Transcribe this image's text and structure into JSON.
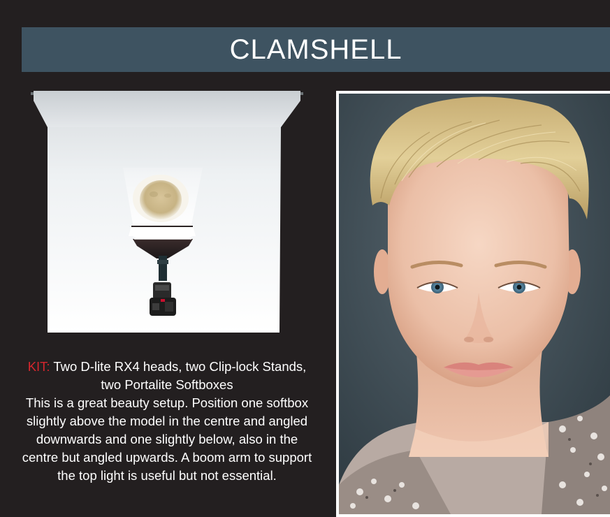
{
  "header": {
    "title": "CLAMSHELL"
  },
  "kit": {
    "label": "KIT:",
    "items": " Two D-lite RX4 heads, two Clip-lock Stands, two Portalite Softboxes",
    "description": "This is a great beauty setup. Position one softbox slightly above the model in the centre and angled downwards and one slightly below, also in the centre but angled upwards. A boom arm to support the top light is useful but not essential."
  },
  "colors": {
    "background": "#231f20",
    "title_bar": "#3e5361",
    "kit_label": "#d7262e",
    "text": "#ffffff"
  },
  "icons": [
    "backdrop-roll",
    "model-head",
    "softbox-top",
    "softbox-bottom",
    "camera-icon"
  ]
}
